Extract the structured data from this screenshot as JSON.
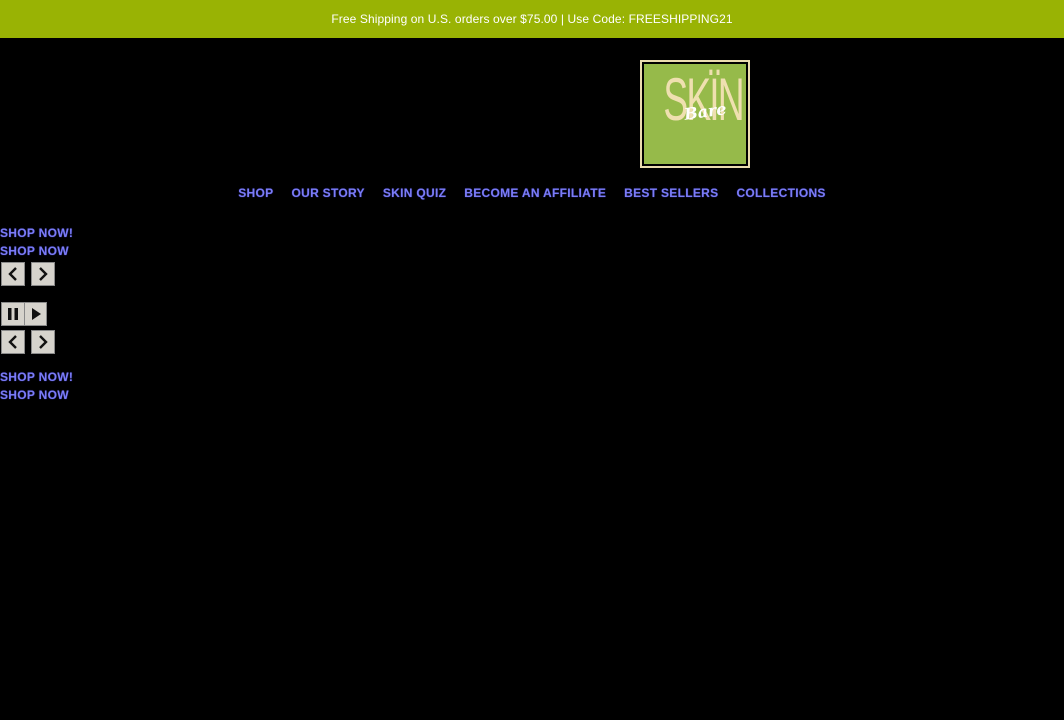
{
  "announcement": {
    "text": "Free Shipping on U.S. orders over $75.00 | Use Code: FREESHIPPING21"
  },
  "logo": {
    "word": "SKÏN",
    "script": "Bare"
  },
  "nav": {
    "items": [
      {
        "label": "SHOP"
      },
      {
        "label": "OUR STORY"
      },
      {
        "label": "SKIN QUIZ"
      },
      {
        "label": "BECOME AN AFFILIATE"
      },
      {
        "label": "BEST SELLERS"
      },
      {
        "label": "COLLECTIONS"
      }
    ]
  },
  "slideshow_top": {
    "links": [
      {
        "label": "SHOP NOW!"
      },
      {
        "label": "SHOP NOW"
      }
    ]
  },
  "slideshow_bottom": {
    "links": [
      {
        "label": "SHOP NOW!"
      },
      {
        "label": "SHOP NOW"
      }
    ]
  },
  "colors": {
    "announce_bg": "#99b304",
    "page_bg": "#000000",
    "link": "#7b7cf5",
    "logo_green": "#96ba4a",
    "logo_cream": "#e9dbae"
  },
  "icons": {
    "prev": "chevron-left-icon",
    "next": "chevron-right-icon",
    "pause": "pause-icon",
    "play": "play-icon"
  }
}
